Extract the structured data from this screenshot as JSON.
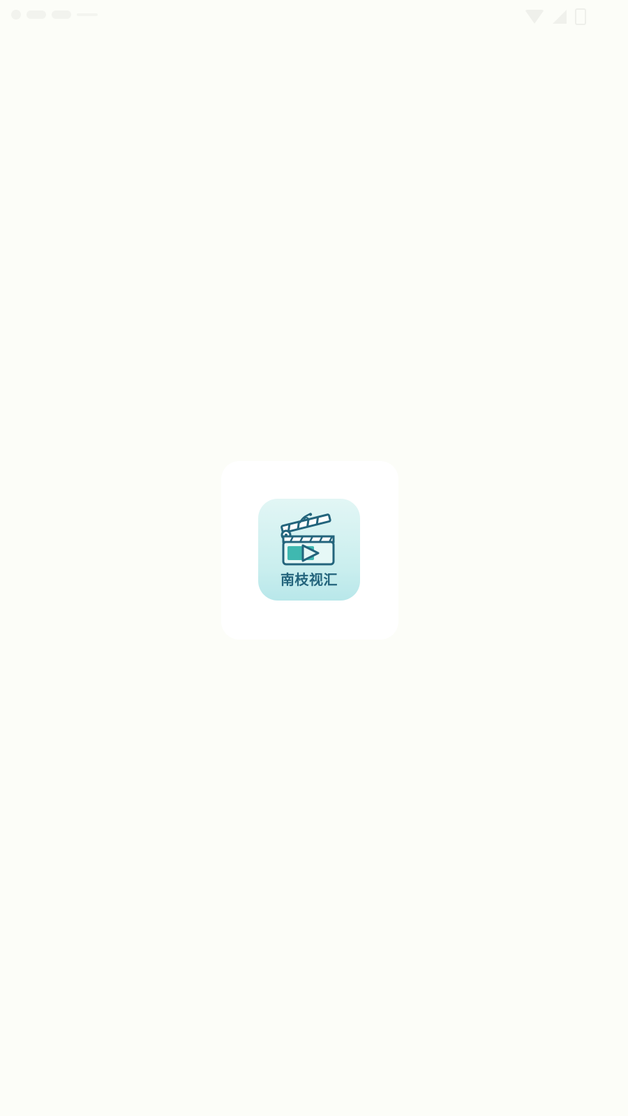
{
  "splash": {
    "app_name": "南枝视汇",
    "logo_icon": "clapperboard-play-icon"
  },
  "status_bar": {
    "icons": [
      "notification-icon",
      "wifi-icon",
      "signal-icon",
      "battery-icon"
    ]
  },
  "colors": {
    "background": "#fcfdf8",
    "card": "#ffffff",
    "icon_gradient_top": "#e2f6f5",
    "icon_gradient_bottom": "#b8e7ea",
    "brand_teal": "#23647c",
    "accent_teal": "#3fb8b0"
  }
}
